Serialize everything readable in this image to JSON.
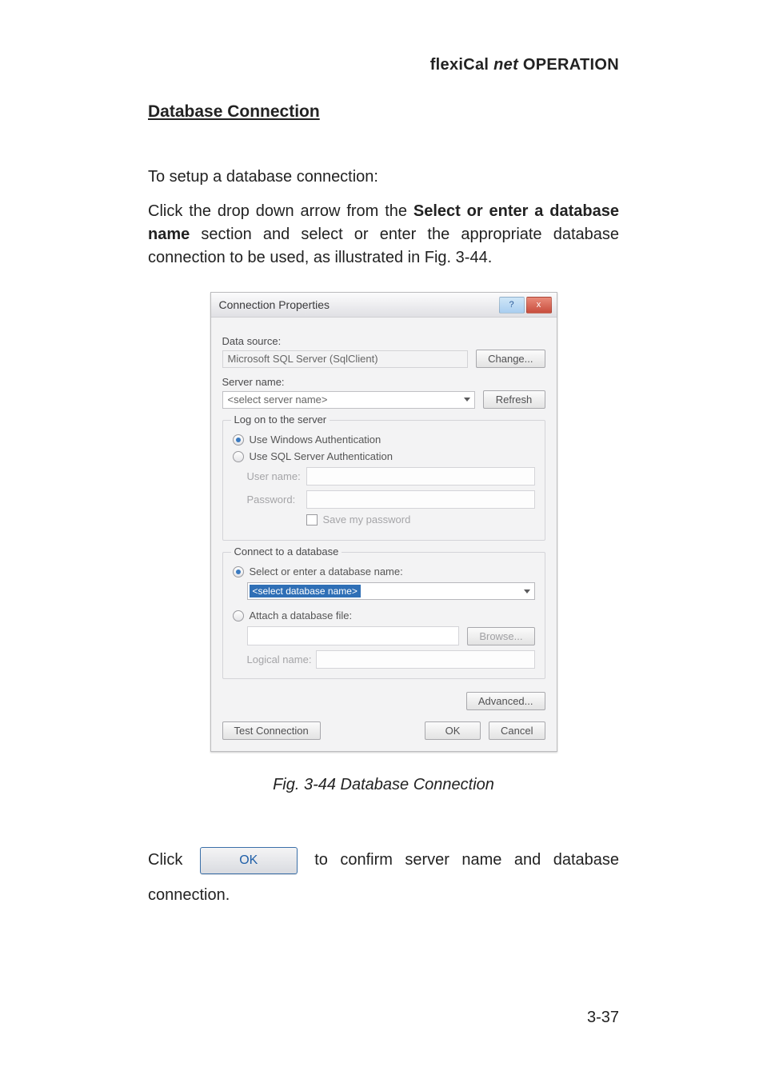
{
  "doc_header": {
    "prefix": "flexiCal ",
    "ital": "net",
    "suffix": " OPERATION"
  },
  "section_title": "Database Connection",
  "intro_text": "To setup a database connection:",
  "para2_prefix": "Click the drop down arrow from the ",
  "para2_bold": "Select or enter a database name",
  "para2_suffix": " section and select or enter the appropriate database connection to be used, as illustrated in Fig. 3-44.",
  "fig_caption": "Fig. 3-44  Database Connection",
  "click_prefix": "Click ",
  "ok_button_label": "OK",
  "click_suffix": " to confirm server name and database connection.",
  "page_number": "3-37",
  "dialog": {
    "title": "Connection Properties",
    "help_icon": "?",
    "close_icon": "x",
    "data_source_label": "Data source:",
    "data_source_value": "Microsoft SQL Server (SqlClient)",
    "change_button": "Change...",
    "server_name_label": "Server name:",
    "server_name_value": "<select server name>",
    "refresh_button": "Refresh",
    "logon_group_title": "Log on to the server",
    "radio_win_auth": "Use Windows Authentication",
    "radio_sql_auth": "Use SQL Server Authentication",
    "username_label": "User name:",
    "password_label": "Password:",
    "save_password_label": "Save my password",
    "connect_group_title": "Connect to a database",
    "radio_select_db": "Select or enter a database name:",
    "db_selected_text": "<select database name>",
    "radio_attach": "Attach a database file:",
    "browse_button": "Browse...",
    "logical_name_label": "Logical name:",
    "advanced_button": "Advanced...",
    "test_connection_button": "Test Connection",
    "ok_button": "OK",
    "cancel_button": "Cancel"
  }
}
